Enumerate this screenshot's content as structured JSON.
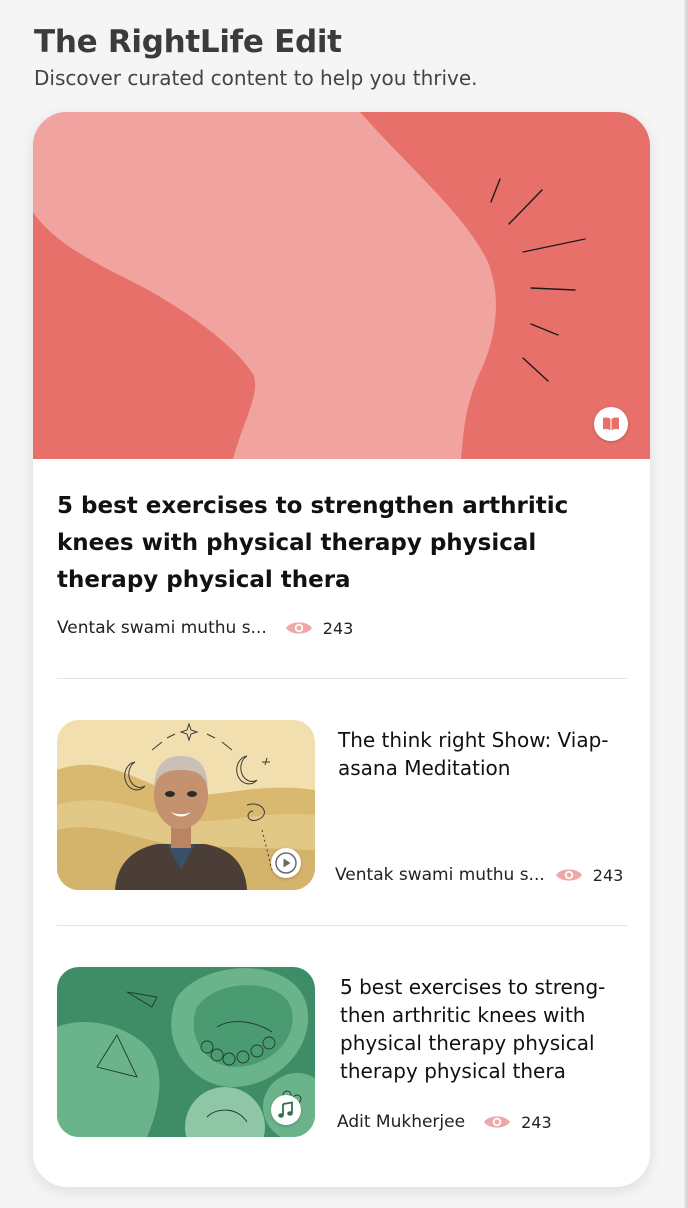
{
  "header": {
    "title": "The RightLife Edit",
    "subtitle": "Discover curated content to help you thrive."
  },
  "featured": {
    "title": "5 best exercises to strengthen arthritic knees with physical therapy physical therapy physical thera",
    "author": "Ventak swami muthu s...",
    "views": "243",
    "badge_icon": "book-icon",
    "colors": {
      "coral": "#e8706b",
      "pink": "#f1a3a0"
    }
  },
  "items": [
    {
      "title": "The think right Show: Viap-asana Meditation",
      "author": "Ventak swami muthu s...",
      "views": "243",
      "badge_icon": "play-icon"
    },
    {
      "title": "5 best exercises to streng-then arthritic knees with physical therapy physical therapy physical thera",
      "author": "Adit Mukherjee",
      "views": "243",
      "badge_icon": "music-note-icon"
    }
  ],
  "eye_icon_color": "#efa7a7"
}
